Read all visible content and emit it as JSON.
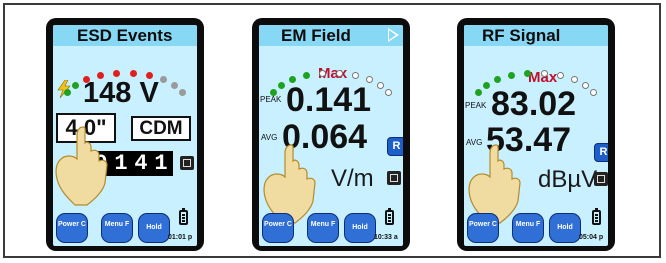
{
  "colors": {
    "screen_bg": "#c9f0ff",
    "title_bg": "#87d8f5",
    "green": "#1fa21f",
    "red": "#e0201e",
    "gray": "#9a9a9a",
    "max_red": "#c0102a",
    "button_blue": "#2f6fd6"
  },
  "devices": [
    {
      "title": "ESD Events",
      "arc": [
        "green",
        "green",
        "red",
        "red",
        "red",
        "red",
        "red",
        "gray",
        "gray",
        "gray"
      ],
      "value": "148 V",
      "distance": "4.0\"",
      "mode": "CDM",
      "counter": [
        "0",
        "1",
        "4",
        "1"
      ],
      "softkeys": {
        "power": "Power C",
        "menu": "Menu F",
        "hold": "Hold"
      },
      "time": "01:01 p",
      "icons": {
        "lightning": "lightning-icon",
        "hand": "pointing-hand-icon",
        "reset": "reset-icon",
        "battery": "battery-icon"
      }
    },
    {
      "title": "EM Field",
      "arc": [
        "green",
        "green",
        "green",
        "green",
        "empty",
        "empty",
        "empty",
        "empty",
        "empty",
        "empty"
      ],
      "max_label": "Max",
      "peak_label": "PEAK",
      "peak_value": "0.141",
      "avg_label": "AVG",
      "avg_value": "0.064",
      "unit": "V/m",
      "r_button": "R",
      "softkeys": {
        "power": "Power C",
        "menu": "Menu F",
        "hold": "Hold"
      },
      "time": "10:33 a",
      "icons": {
        "next": "play-icon",
        "hand": "pointing-hand-icon",
        "reset": "reset-icon",
        "battery": "battery-icon"
      }
    },
    {
      "title": "RF Signal",
      "arc": [
        "green",
        "green",
        "green",
        "green",
        "green",
        "empty",
        "empty",
        "empty",
        "empty",
        "empty"
      ],
      "max_label": "Max",
      "peak_label": "PEAK",
      "peak_value": "83.02",
      "avg_label": "AVG",
      "avg_value": "53.47",
      "unit": "dBµV",
      "r_button": "R",
      "softkeys": {
        "power": "Power C",
        "menu": "Menu F",
        "hold": "Hold"
      },
      "time": "05:04 p",
      "icons": {
        "hand": "pointing-hand-icon",
        "reset": "reset-icon",
        "battery": "battery-icon"
      }
    }
  ]
}
